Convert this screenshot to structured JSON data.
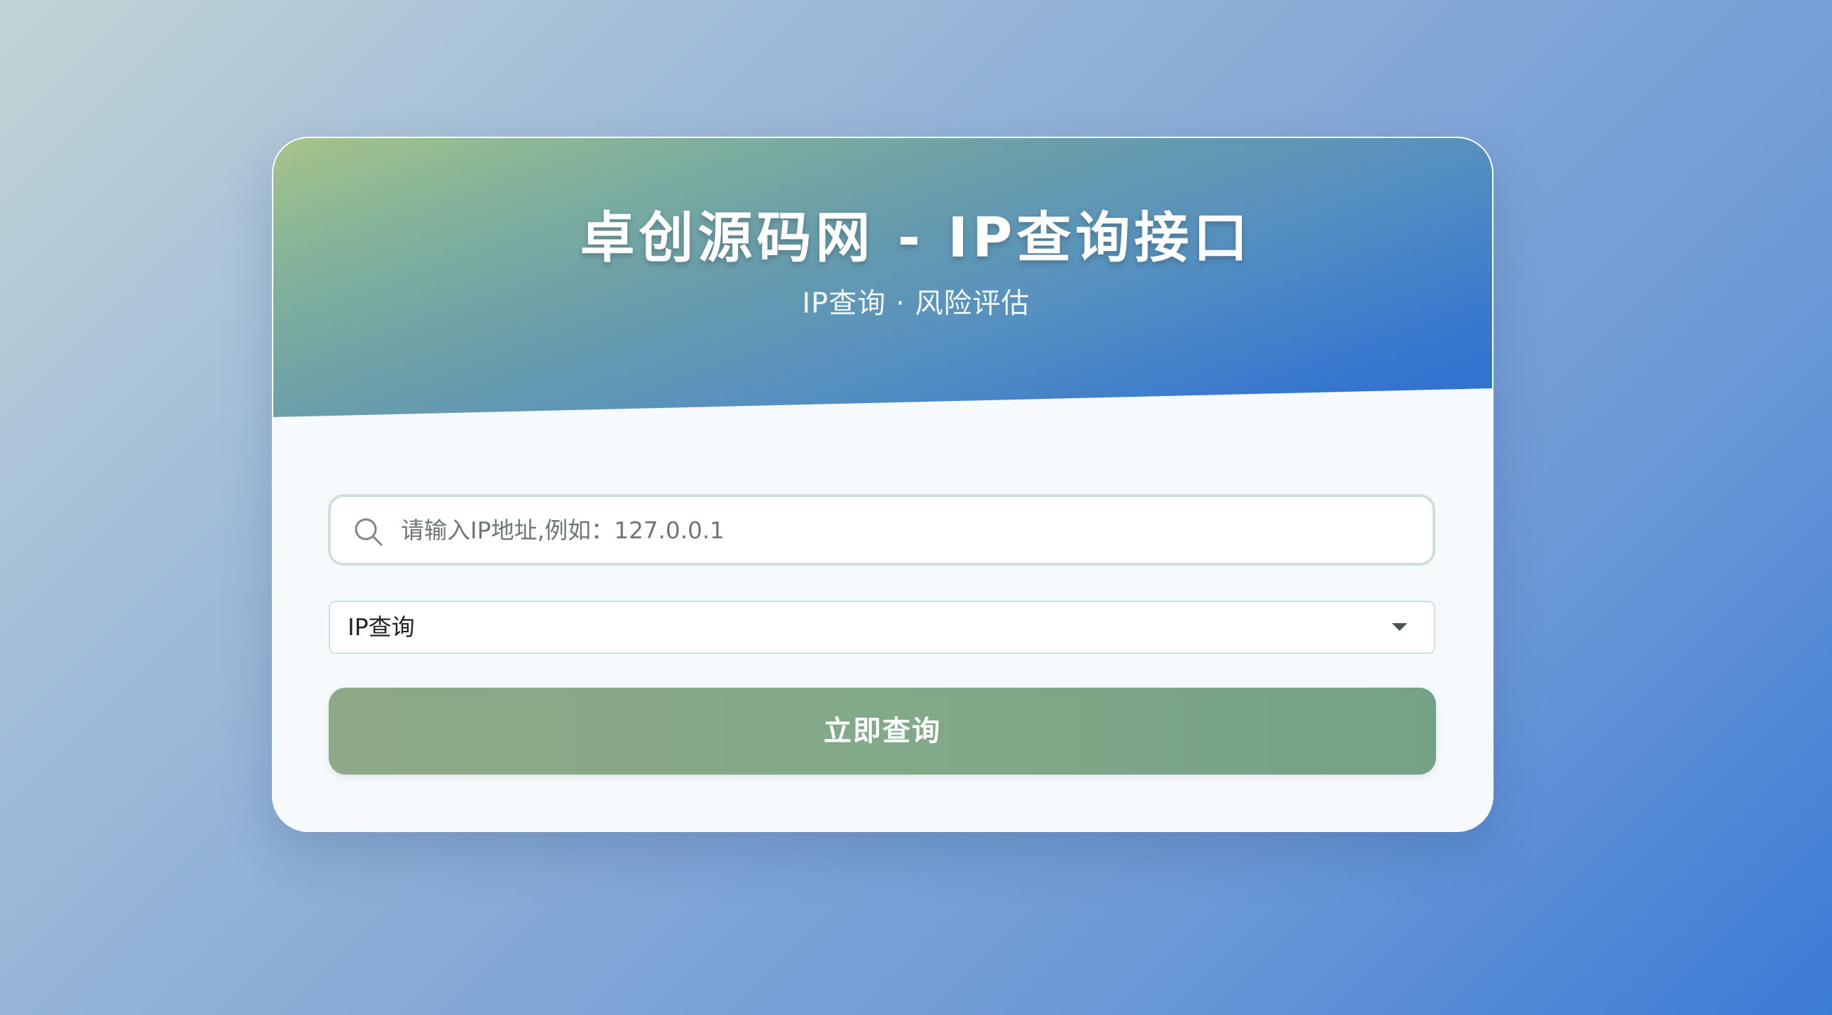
{
  "header": {
    "title": "卓创源码网 - IP查询接口",
    "subtitle": "IP查询 · 风险评估"
  },
  "search": {
    "placeholder": "请输入IP地址,例如：127.0.0.1",
    "value": "",
    "icon": "search-icon"
  },
  "query_type": {
    "selected": "IP查询",
    "icon": "chevron-down-icon"
  },
  "submit": {
    "label": "立即查询"
  },
  "colors": {
    "button": "#82a988",
    "header_start": "#a7c48a",
    "header_end": "#3576d0"
  }
}
